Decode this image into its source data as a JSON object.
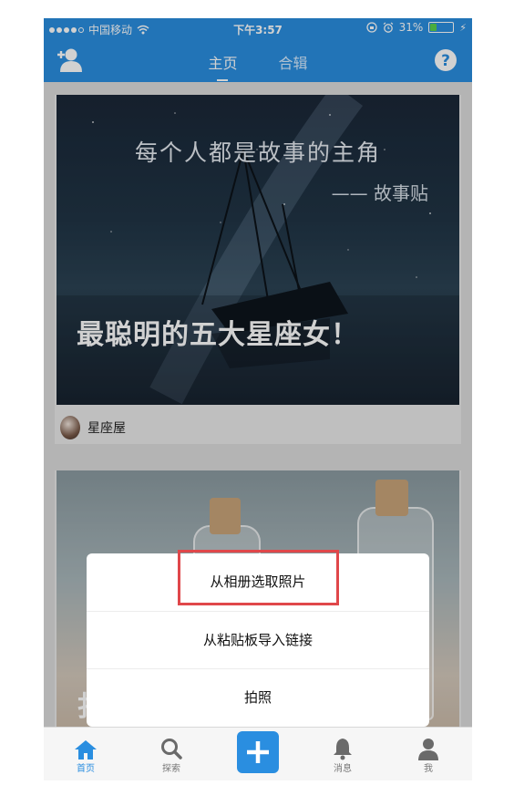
{
  "status_bar": {
    "carrier": "中国移动",
    "time": "下午3:57",
    "battery_percent": "31%",
    "battery_level": 0.31,
    "icons": [
      "signal-dots-icon",
      "wifi-icon",
      "lock-rotation-icon",
      "alarm-icon",
      "battery-icon",
      "charging-icon"
    ]
  },
  "nav": {
    "tabs": [
      {
        "label": "主页",
        "active": true
      },
      {
        "label": "合辑",
        "active": false
      }
    ],
    "left_icon": "add-user-icon",
    "right_icon": "help-icon"
  },
  "feed": {
    "cards": [
      {
        "image_text_line1": "每个人都是故事的主角",
        "image_text_line2": "—— 故事贴",
        "headline": "最聪明的五大星座女！",
        "author": "星座屋"
      },
      {
        "headline_partial": "扌"
      }
    ]
  },
  "action_sheet": {
    "items": [
      {
        "label": "从相册选取照片",
        "highlighted": true
      },
      {
        "label": "从粘贴板导入链接",
        "highlighted": false
      },
      {
        "label": "拍照",
        "highlighted": false
      }
    ]
  },
  "tab_bar": {
    "items": [
      {
        "label": "首页",
        "icon": "home-icon",
        "active": true
      },
      {
        "label": "探索",
        "icon": "search-icon",
        "active": false
      },
      {
        "label": "",
        "icon": "plus-icon",
        "active": false
      },
      {
        "label": "消息",
        "icon": "bell-icon",
        "active": false
      },
      {
        "label": "我",
        "icon": "user-icon",
        "active": false
      }
    ]
  },
  "colors": {
    "brand_blue": "#2a8ee0",
    "highlight_red": "#e0474a",
    "battery_green": "#5ad24e"
  }
}
